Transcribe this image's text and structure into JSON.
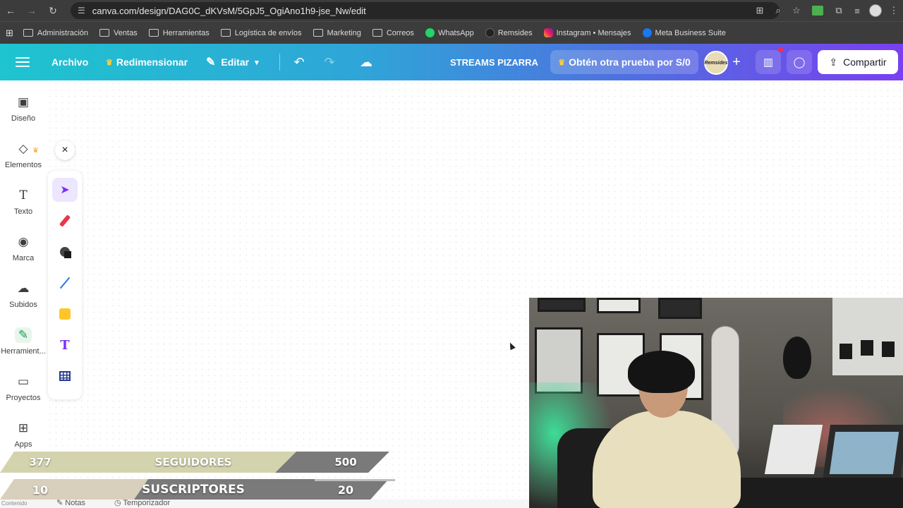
{
  "browser": {
    "url": "canva.com/design/DAG0C_dKVsM/5GpJ5_OgiAno1h9-jse_Nw/edit",
    "bookmarks": [
      {
        "label": "Administración",
        "icon": "folder-icon"
      },
      {
        "label": "Ventas",
        "icon": "folder-icon"
      },
      {
        "label": "Herramientas",
        "icon": "folder-icon"
      },
      {
        "label": "Logística de envíos",
        "icon": "folder-icon"
      },
      {
        "label": "Marketing",
        "icon": "folder-icon"
      },
      {
        "label": "Correos",
        "icon": "folder-icon"
      },
      {
        "label": "WhatsApp",
        "icon": "whatsapp-icon"
      },
      {
        "label": "Remsides",
        "icon": "remsides-icon"
      },
      {
        "label": "Instagram • Mensajes",
        "icon": "instagram-icon"
      },
      {
        "label": "Meta Business Suite",
        "icon": "meta-icon"
      }
    ]
  },
  "header": {
    "file_label": "Archivo",
    "resize_label": "Redimensionar",
    "edit_label": "Editar",
    "title": "STREAMS PIZARRA",
    "trial_label": "Obtén otra prueba por S/0",
    "avatar_text": "Remsides",
    "share_label": "Compartir"
  },
  "sidebar": {
    "items": [
      {
        "label": "Diseño",
        "icon": "design-icon"
      },
      {
        "label": "Elementos",
        "icon": "elements-icon"
      },
      {
        "label": "Texto",
        "icon": "text-icon"
      },
      {
        "label": "Marca",
        "icon": "brand-icon"
      },
      {
        "label": "Subidos",
        "icon": "upload-icon"
      },
      {
        "label": "Herramient...",
        "icon": "tools-icon"
      },
      {
        "label": "Proyectos",
        "icon": "folder-icon"
      },
      {
        "label": "Apps",
        "icon": "apps-icon"
      }
    ]
  },
  "draw_tools": [
    "select-tool",
    "pen-tool",
    "marker-tool",
    "line-tool",
    "sticky-note-tool",
    "text-tool",
    "table-tool"
  ],
  "stats": {
    "followers": {
      "current": "377",
      "label": "SEGUIDORES",
      "goal": "500"
    },
    "subscribers": {
      "current": "10",
      "label": "SUSCRIPTORES",
      "goal": "20"
    }
  },
  "footer": {
    "notes_label": "Notas",
    "timer_label": "Temporizador",
    "content_label": "Contenido"
  },
  "colors": {
    "header_gradient_start": "#1ec4cf",
    "header_gradient_end": "#7a3ff0",
    "accent_green": "#1a9c4e",
    "stat_khaki": "#cfcfa8",
    "stat_gray": "#7d7d7d"
  }
}
